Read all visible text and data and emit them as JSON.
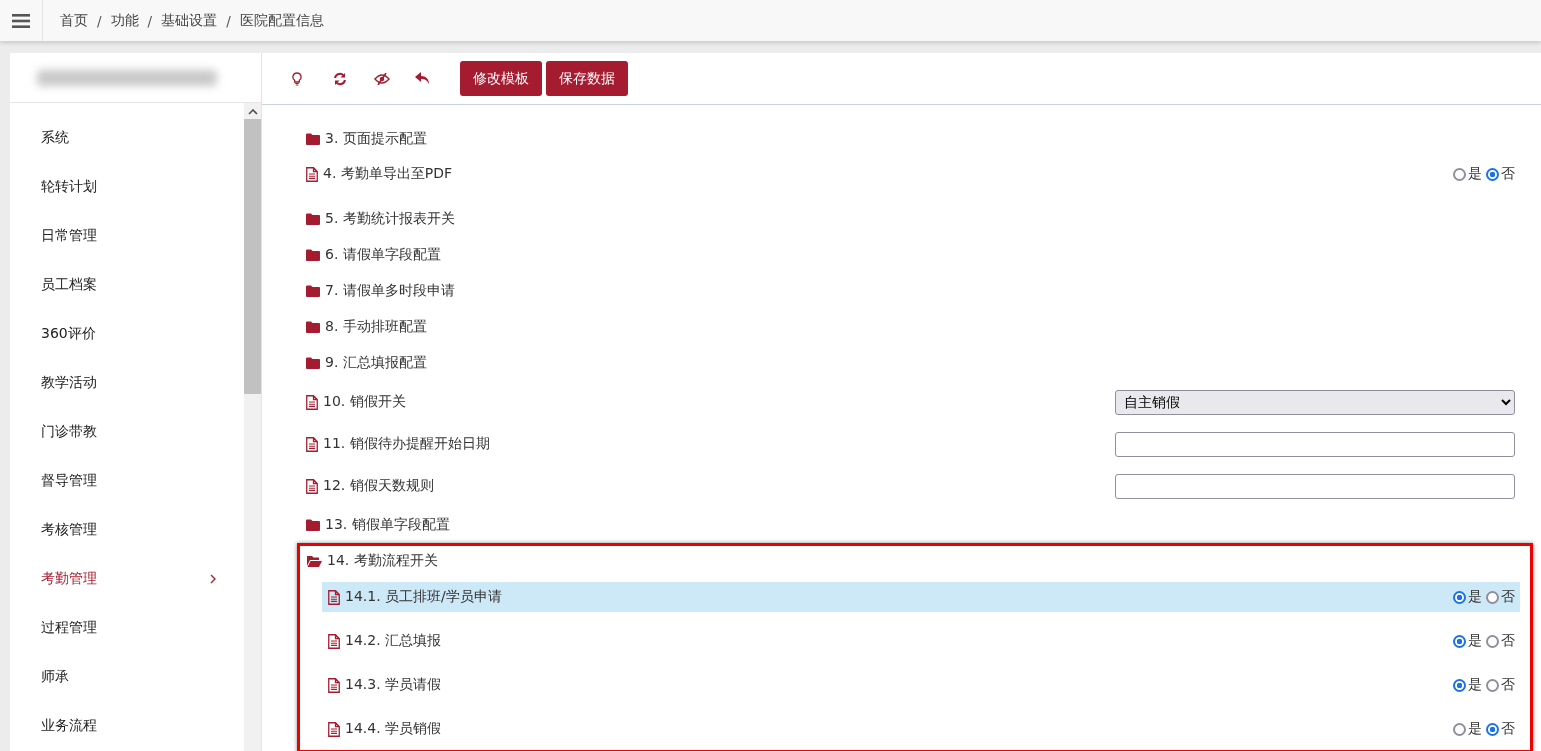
{
  "topbar": {
    "breadcrumb": [
      "首页",
      "功能",
      "基础设置",
      "医院配置信息"
    ],
    "separator": "/"
  },
  "sidebar": {
    "items": [
      {
        "label": "系统",
        "selected": false
      },
      {
        "label": "轮转计划",
        "selected": false
      },
      {
        "label": "日常管理",
        "selected": false
      },
      {
        "label": "员工档案",
        "selected": false
      },
      {
        "label": "360评价",
        "selected": false
      },
      {
        "label": "教学活动",
        "selected": false
      },
      {
        "label": "门诊带教",
        "selected": false
      },
      {
        "label": "督导管理",
        "selected": false
      },
      {
        "label": "考核管理",
        "selected": false
      },
      {
        "label": "考勤管理",
        "selected": true
      },
      {
        "label": "过程管理",
        "selected": false
      },
      {
        "label": "师承",
        "selected": false
      },
      {
        "label": "业务流程",
        "selected": false
      }
    ]
  },
  "toolbar": {
    "buttons": [
      "修改模板",
      "保存数据"
    ]
  },
  "config": {
    "items": [
      {
        "kind": "folder",
        "label": "3. 页面提示配置"
      },
      {
        "kind": "toggle",
        "label": "4. 考勤单导出至PDF",
        "options": [
          {
            "label": "是",
            "selected": false
          },
          {
            "label": "否",
            "selected": true
          }
        ]
      },
      {
        "kind": "folder",
        "label": "5. 考勤统计报表开关"
      },
      {
        "kind": "folder",
        "label": "6. 请假单字段配置"
      },
      {
        "kind": "folder",
        "label": "7. 请假单多时段申请"
      },
      {
        "kind": "folder",
        "label": "8. 手动排班配置"
      },
      {
        "kind": "folder",
        "label": "9. 汇总填报配置"
      },
      {
        "kind": "select",
        "label": "10. 销假开关",
        "value": "自主销假"
      },
      {
        "kind": "text",
        "label": "11. 销假待办提醒开始日期"
      },
      {
        "kind": "text",
        "label": "12. 销假天数规则"
      },
      {
        "kind": "folder",
        "label": "13. 销假单字段配置"
      },
      {
        "kind": "folder",
        "label": "14. 考勤流程开关",
        "expanded": true,
        "highlighted": true,
        "children": [
          {
            "kind": "toggle",
            "label": "14.1. 员工排班/学员申请",
            "selected": true,
            "options": [
              {
                "label": "是",
                "selected": true
              },
              {
                "label": "否",
                "selected": false
              }
            ]
          },
          {
            "kind": "toggle",
            "label": "14.2. 汇总填报",
            "selected": false,
            "options": [
              {
                "label": "是",
                "selected": true
              },
              {
                "label": "否",
                "selected": false
              }
            ]
          },
          {
            "kind": "toggle",
            "label": "14.3. 学员请假",
            "selected": false,
            "options": [
              {
                "label": "是",
                "selected": true
              },
              {
                "label": "否",
                "selected": false
              }
            ]
          },
          {
            "kind": "toggle",
            "label": "14.4. 学员销假",
            "selected": false,
            "options": [
              {
                "label": "是",
                "selected": false
              },
              {
                "label": "否",
                "selected": true
              }
            ]
          }
        ]
      }
    ]
  }
}
